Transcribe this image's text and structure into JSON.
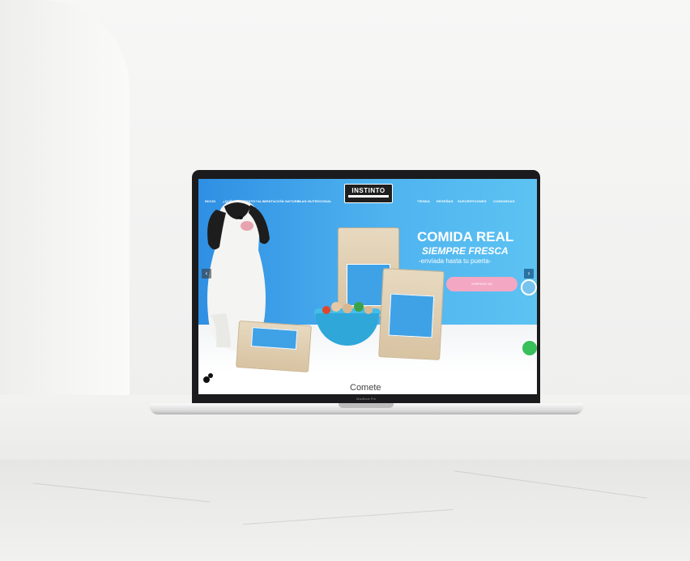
{
  "screen": {
    "logo_text": "INSTINTO",
    "nav_left": [
      "INICIO",
      "¿QUÉ ES INSTINTO?",
      "ALIMENTACIÓN NATURAL",
      "PLAN NUTRICIONAL"
    ],
    "nav_right": [
      "TIENDA",
      "RESEÑAS",
      "SUSCRIPCIONES",
      "COMUNIDAD"
    ],
    "headline": "COMIDA REAL",
    "subheadline": "SIEMPRE FRESCA",
    "tagline": "-envíada hasta tu puerta-",
    "cta_label": "¡EMPIEZA YA!",
    "bottom_text": "Comete",
    "colors": {
      "hero_blue": "#3ea6ea",
      "cta_pink": "#f3a7c3",
      "whatsapp_green": "#39c05b"
    }
  },
  "laptop": {
    "model_label": "MacBook Pro"
  }
}
